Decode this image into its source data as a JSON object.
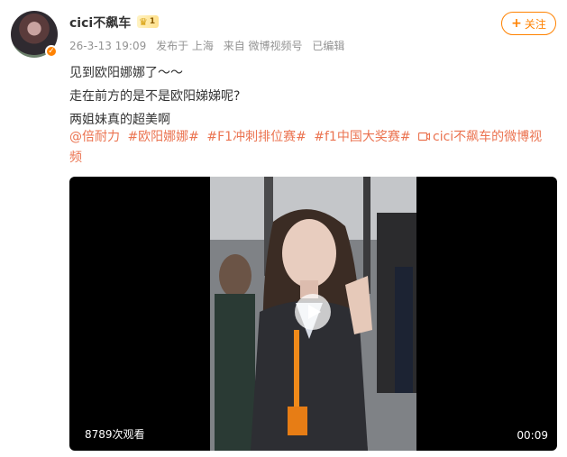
{
  "post": {
    "author": {
      "name": "cici不飙车",
      "vip_level": "1"
    },
    "follow_label": "关注",
    "meta": {
      "time": "26-3-13 19:09",
      "location": "发布于 上海",
      "source": "来自 微博视频号",
      "edited": "已编辑"
    },
    "text_lines": [
      "见到欧阳娜娜了～～",
      "走在前方的是不是欧阳娣娣呢?",
      "两姐妹真的超美啊"
    ],
    "tags": {
      "mention": "@倍耐力",
      "topic1": "#欧阳娜娜#",
      "topic2": "#F1冲刺排位赛#",
      "topic3": "#f1中国大奖赛#",
      "video_link": "cici不飙车的微博视频"
    },
    "video": {
      "views": "8789次观看",
      "duration": "00:09"
    },
    "colors": {
      "accent": "#ff8200",
      "link": "#eb7350",
      "meta_text": "#939393"
    }
  }
}
